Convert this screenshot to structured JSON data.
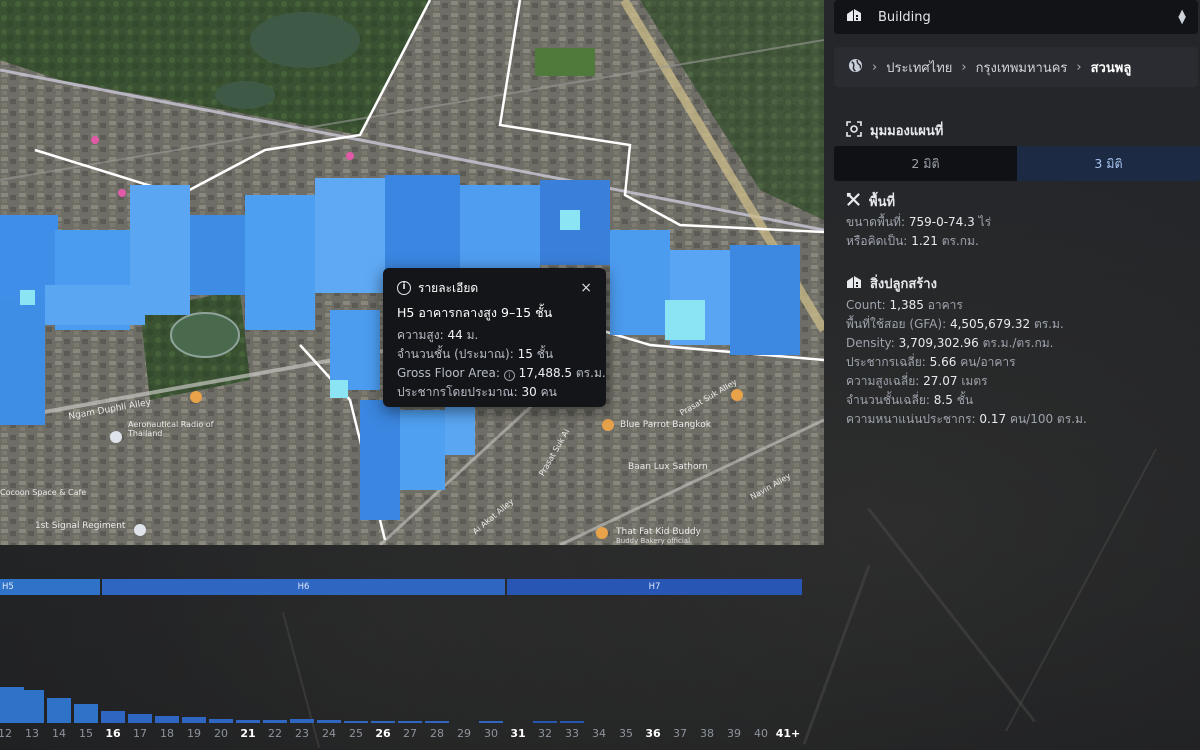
{
  "selector": {
    "label": "Building",
    "icon": "building-icon"
  },
  "breadcrumb": {
    "icon": "globe-icon",
    "items": [
      "ประเทศไทย",
      "กรุงเทพมหานคร",
      "สวนพลู"
    ]
  },
  "view": {
    "title": "มุมมองแผนที่",
    "icon": "view-icon",
    "options": [
      "2 มิติ",
      "3 มิติ"
    ],
    "selected": "3 มิติ"
  },
  "area": {
    "title": "พื้นที่",
    "icon": "tools-icon",
    "size_label": "ขนาดพื้นที่:",
    "size_value": "759-0-74.3",
    "size_unit": "ไร่",
    "equiv_label": "หรือคิดเป็น:",
    "equiv_value": "1.21",
    "equiv_unit": "ตร.กม."
  },
  "buildings": {
    "title": "สิ่งปลูกสร้าง",
    "icon": "building-icon",
    "stats": [
      {
        "label": "Count:",
        "value": "1,385",
        "unit": "อาคาร"
      },
      {
        "label": "พื้นที่ใช้สอย (GFA):",
        "value": "4,505,679.32",
        "unit": "ตร.ม."
      },
      {
        "label": "Density:",
        "value": "3,709,302.96",
        "unit": "ตร.ม./ตร.กม."
      },
      {
        "label": "ประชากรเฉลี่ย:",
        "value": "5.66",
        "unit": "คน/อาคาร"
      },
      {
        "label": "ความสูงเฉลี่ย:",
        "value": "27.07",
        "unit": "เมตร"
      },
      {
        "label": "จำนวนชั้นเฉลี่ย:",
        "value": "8.5",
        "unit": "ชั้น"
      },
      {
        "label": "ความหนาแน่นประชากร:",
        "value": "0.17",
        "unit": "คน/100 ตร.ม."
      }
    ]
  },
  "popup": {
    "title": "รายละเอียด",
    "close": "×",
    "subtitle": "H5 อาคารกลางสูง 9–15 ชั้น",
    "rows": [
      {
        "label": "ความสูง:",
        "value": "44",
        "unit": "ม."
      },
      {
        "label": "จำนวนชั้น (ประมาณ):",
        "value": "15",
        "unit": "ชั้น"
      },
      {
        "label": "Gross Floor Area:",
        "value": "17,488.5",
        "unit": "ตร.ม."
      },
      {
        "label": "ประชากรโดยประมาณ:",
        "value": "30",
        "unit": "คน"
      }
    ]
  },
  "map_labels": [
    "Ngam Duphli Alley",
    "Aeronautical Radio of Thailand",
    "Cocoon Space & Cafe",
    "1st Signal Regiment",
    "Blue Parrot Bangkok",
    "Baan Lux Sathorn",
    "Prasat Suk Alley",
    "Navin Alley",
    "That Fat Kid Buddy",
    "Buddy Bakery official",
    "Ai Akat Alley",
    "Prasat Suk Ai"
  ],
  "histogram": {
    "bands": [
      "H5",
      "H6",
      "H7"
    ],
    "ticks": [
      "12",
      "13",
      "14",
      "15",
      "16",
      "17",
      "18",
      "19",
      "20",
      "21",
      "22",
      "23",
      "24",
      "25",
      "26",
      "27",
      "28",
      "29",
      "30",
      "31",
      "32",
      "33",
      "34",
      "35",
      "36",
      "37",
      "38",
      "39",
      "40",
      "41+"
    ],
    "bold_ticks": [
      "16",
      "21",
      "26",
      "31",
      "36",
      "41+"
    ],
    "values": [
      60,
      55,
      42,
      32,
      20,
      15,
      12,
      10,
      6,
      5,
      5,
      6,
      5,
      3,
      3,
      2,
      1,
      0,
      2,
      0,
      2,
      2,
      0,
      0,
      0,
      0,
      0,
      0,
      0,
      0
    ]
  },
  "colors": {
    "building_light": "#5ea8f2",
    "building_dark": "#2f74d4",
    "building_cyan": "#8be4f4",
    "band_h5": "#2f73c9",
    "band_h6": "#2e66c1",
    "band_h7": "#2756b4"
  }
}
